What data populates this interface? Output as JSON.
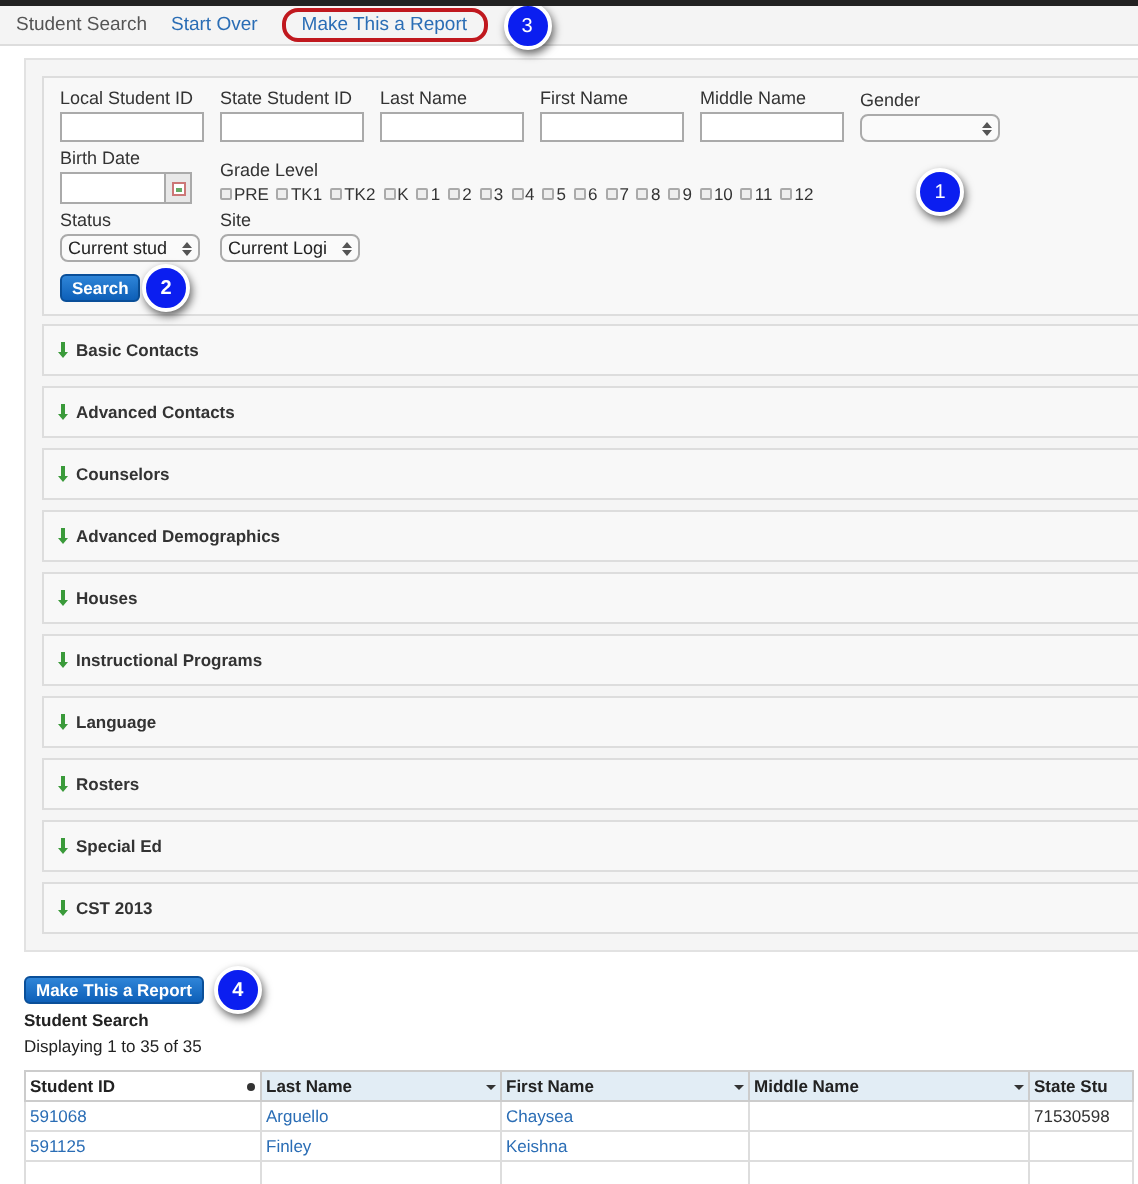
{
  "nav": [
    {
      "label": "Student Search",
      "kind": "title",
      "highlighted": false
    },
    {
      "label": "Start Over",
      "kind": "link",
      "highlighted": false
    },
    {
      "label": "Make This a Report",
      "kind": "link",
      "highlighted": true
    }
  ],
  "callouts": {
    "grades": "1",
    "search": "2",
    "nav": "3",
    "report": "4"
  },
  "fields": [
    {
      "label": "Local Student ID",
      "kind": "text"
    },
    {
      "label": "State Student ID",
      "kind": "text"
    },
    {
      "label": "Last Name",
      "kind": "text"
    },
    {
      "label": "First Name",
      "kind": "text"
    },
    {
      "label": "Middle Name",
      "kind": "text"
    },
    {
      "label": "Gender",
      "kind": "select"
    }
  ],
  "birth_date": {
    "label": "Birth Date"
  },
  "grade_level": {
    "label": "Grade Level",
    "grades": [
      {
        "label": "PRE",
        "checked": false
      },
      {
        "label": "TK1",
        "checked": false
      },
      {
        "label": "TK2",
        "checked": false
      },
      {
        "label": "K",
        "checked": false
      },
      {
        "label": "1",
        "checked": false
      },
      {
        "label": "2",
        "checked": false
      },
      {
        "label": "3",
        "checked": false
      },
      {
        "label": "4",
        "checked": false
      },
      {
        "label": "5",
        "checked": false
      },
      {
        "label": "6",
        "checked": false
      },
      {
        "label": "7",
        "checked": false
      },
      {
        "label": "8",
        "checked": false
      },
      {
        "label": "9",
        "checked": false
      },
      {
        "label": "10",
        "checked": false
      },
      {
        "label": "11",
        "checked": false
      },
      {
        "label": "12",
        "checked": false
      }
    ]
  },
  "status": {
    "label": "Status",
    "value": "Current stud"
  },
  "site": {
    "label": "Site",
    "value": "Current Logi"
  },
  "search_button": "Search",
  "sections": [
    {
      "title": "Basic Contacts",
      "expanded": false
    },
    {
      "title": "Advanced Contacts",
      "expanded": false
    },
    {
      "title": "Counselors",
      "expanded": false
    },
    {
      "title": "Advanced Demographics",
      "expanded": false
    },
    {
      "title": "Houses",
      "expanded": false
    },
    {
      "title": "Instructional Programs",
      "expanded": false
    },
    {
      "title": "Language",
      "expanded": false
    },
    {
      "title": "Rosters",
      "expanded": false
    },
    {
      "title": "Special Ed",
      "expanded": false
    },
    {
      "title": "CST 2013",
      "expanded": false
    }
  ],
  "report_button": "Make This a Report",
  "results": {
    "title": "Student Search",
    "summary": "Displaying 1 to 35 of 35",
    "columns": [
      {
        "label": "Student ID",
        "sorted": true
      },
      {
        "label": "Last Name",
        "sorted": false
      },
      {
        "label": "First Name",
        "sorted": false
      },
      {
        "label": "Middle Name",
        "sorted": false
      },
      {
        "label": "State Stu",
        "sorted": false
      }
    ],
    "rows": [
      [
        "591068",
        "Arguello",
        "Chaysea",
        "",
        "71530598"
      ],
      [
        "591125",
        "Finley",
        "Keishna",
        "",
        ""
      ]
    ]
  }
}
